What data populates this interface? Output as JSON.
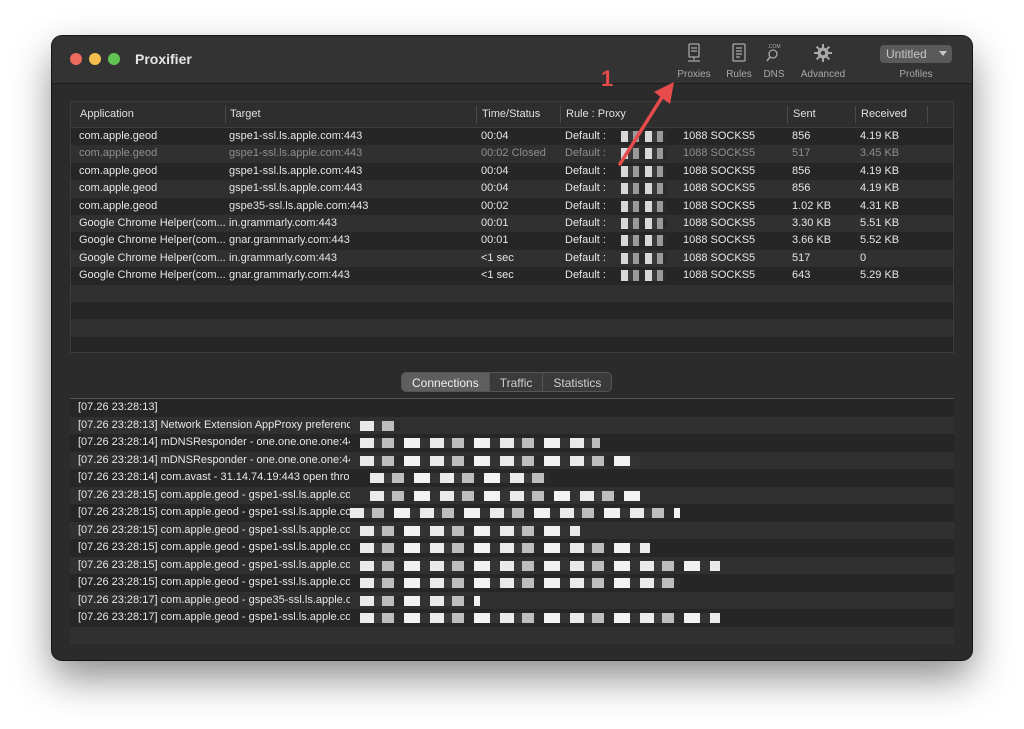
{
  "window": {
    "title": "Proxifier"
  },
  "toolbar": {
    "proxies": "Proxies",
    "rules": "Rules",
    "dns": "DNS",
    "dns_badge": ".COM",
    "advanced": "Advanced",
    "profile_value": "Untitled",
    "profiles": "Profiles"
  },
  "annotation": {
    "number": "1",
    "color": "#e74c4c"
  },
  "connections": {
    "columns": [
      "Application",
      "Target",
      "Time/Status",
      "Rule : Proxy",
      "Sent",
      "Received"
    ],
    "rows": [
      {
        "app": "com.apple.geod",
        "target": "gspe1-ssl.ls.apple.com:443",
        "time": "00:04",
        "rule": "Default : ",
        "proxy": "1088 SOCKS5",
        "sent": "856",
        "received": "4.19 KB",
        "closed": false
      },
      {
        "app": "com.apple.geod",
        "target": "gspe1-ssl.ls.apple.com:443",
        "time": "00:02 Closed",
        "rule": "Default : ",
        "proxy": "1088 SOCKS5",
        "sent": "517",
        "received": "3.45 KB",
        "closed": true
      },
      {
        "app": "com.apple.geod",
        "target": "gspe1-ssl.ls.apple.com:443",
        "time": "00:04",
        "rule": "Default : ",
        "proxy": "1088 SOCKS5",
        "sent": "856",
        "received": "4.19 KB",
        "closed": false
      },
      {
        "app": "com.apple.geod",
        "target": "gspe1-ssl.ls.apple.com:443",
        "time": "00:04",
        "rule": "Default : ",
        "proxy": "1088 SOCKS5",
        "sent": "856",
        "received": "4.19 KB",
        "closed": false
      },
      {
        "app": "com.apple.geod",
        "target": "gspe35-ssl.ls.apple.com:443",
        "time": "00:02",
        "rule": "Default : ",
        "proxy": "1088 SOCKS5",
        "sent": "1.02 KB",
        "received": "4.31 KB",
        "closed": false
      },
      {
        "app": "Google Chrome Helper(com...",
        "target": "in.grammarly.com:443",
        "time": "00:01",
        "rule": "Default : ",
        "proxy": "1088 SOCKS5",
        "sent": "3.30 KB",
        "received": "5.51 KB",
        "closed": false
      },
      {
        "app": "Google Chrome Helper(com...",
        "target": "gnar.grammarly.com:443",
        "time": "00:01",
        "rule": "Default : ",
        "proxy": "1088 SOCKS5",
        "sent": "3.66 KB",
        "received": "5.52 KB",
        "closed": false
      },
      {
        "app": "Google Chrome Helper(com...",
        "target": "in.grammarly.com:443",
        "time": "<1 sec",
        "rule": "Default : ",
        "proxy": "1088 SOCKS5",
        "sent": "517",
        "received": "0",
        "closed": false
      },
      {
        "app": "Google Chrome Helper(com...",
        "target": "gnar.grammarly.com:443",
        "time": "<1 sec",
        "rule": "Default : ",
        "proxy": "1088 SOCKS5",
        "sent": "643",
        "received": "5.29 KB",
        "closed": false
      }
    ]
  },
  "tabs": [
    {
      "label": "Connections",
      "active": true
    },
    {
      "label": "Traffic",
      "active": false
    },
    {
      "label": "Statistics",
      "active": false
    }
  ],
  "log": [
    "[07.26 23:28:13]",
    "[07.26 23:28:13] Network Extension AppProxy preferenc",
    "[07.26 23:28:14] mDNSResponder - one.one.one.one:44",
    "[07.26 23:28:14] mDNSResponder - one.one.one.one:44",
    "[07.26 23:28:14] com.avast - 31.14.74.19:443 open throu",
    "[07.26 23:28:15] com.apple.geod - gspe1-ssl.ls.apple.co",
    "[07.26 23:28:15] com.apple.geod - gspe1-ssl.ls.apple.co",
    "[07.26 23:28:15] com.apple.geod - gspe1-ssl.ls.apple.co",
    "[07.26 23:28:15] com.apple.geod - gspe1-ssl.ls.apple.co",
    "[07.26 23:28:15] com.apple.geod - gspe1-ssl.ls.apple.co",
    "[07.26 23:28:15] com.apple.geod - gspe1-ssl.ls.apple.co",
    "[07.26 23:28:17] com.apple.geod - gspe35-ssl.ls.apple.c",
    "[07.26 23:28:17] com.apple.geod - gspe1-ssl.ls.apple.co"
  ]
}
